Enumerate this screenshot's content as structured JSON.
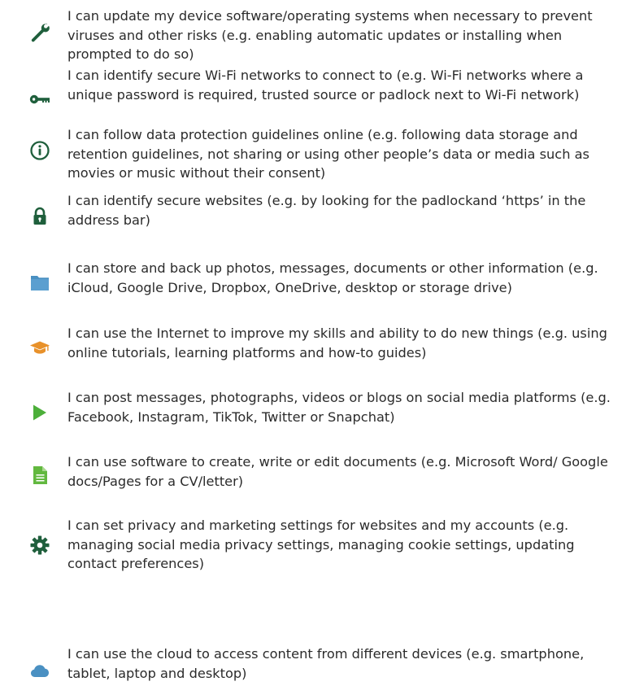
{
  "items": [
    {
      "icon": "wrench-icon",
      "color": "#1f5f3c",
      "text": "I can update my device software/operating systems when necessary to prevent viruses and other risks (e.g. enabling automatic updates or installing when prompted to do so)"
    },
    {
      "icon": "key-icon",
      "color": "#1f5f3c",
      "text": "I can identify secure Wi-Fi networks to connect to (e.g. Wi-Fi networks where a unique password is required, trusted source or padlock next to Wi-Fi network)"
    },
    {
      "icon": "info-icon",
      "color": "#1f5f3c",
      "text": "I can follow data protection guidelines online (e.g. following data storage and retention guidelines, not sharing or using other people’s data or media such as movies or music without their consent)"
    },
    {
      "icon": "padlock-icon",
      "color": "#1f5f3c",
      "text": "I can identify secure websites (e.g. by looking for the padlockand ‘https’ in the address bar)"
    },
    {
      "icon": "folder-icon",
      "color": "#4a90c2",
      "text": "I can store and back up photos, messages, documents or other information (e.g. iCloud, Google Drive, Dropbox, OneDrive, desktop or storage drive)"
    },
    {
      "icon": "graduation-cap-icon",
      "color": "#e8912a",
      "text": "I can use the Internet to improve my skills and ability to do new things (e.g. using online tutorials, learning platforms and how-to guides)"
    },
    {
      "icon": "play-icon",
      "color": "#4caf3a",
      "text": "I can post messages, photographs, videos or blogs on social media platforms (e.g. Facebook, Instagram, TikTok, Twitter or Snapchat)"
    },
    {
      "icon": "document-icon",
      "color": "#62b83f",
      "text": "I can use software to create, write or edit documents (e.g. Microsoft Word/ Google docs/Pages for a CV/letter)"
    },
    {
      "icon": "gear-icon",
      "color": "#1f5f3c",
      "text": "I can set privacy and marketing settings for websites and my accounts (e.g. managing social media privacy settings, managing cookie settings, updating contact preferences)"
    },
    {
      "icon": "cloud-icon",
      "color": "#4a90c2",
      "text": "I can use the cloud to access content from different devices (e.g. smartphone, tablet, laptop and desktop)"
    }
  ]
}
